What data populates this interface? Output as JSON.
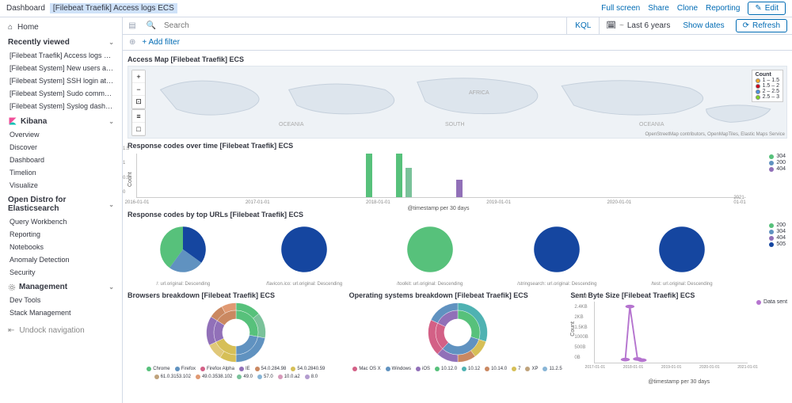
{
  "header": {
    "crumb_root": "Dashboard",
    "crumb_current": "[Filebeat Traefik] Access logs ECS",
    "actions": [
      "Full screen",
      "Share",
      "Clone",
      "Reporting"
    ],
    "edit_label": "Edit"
  },
  "sidebar": {
    "home": "Home",
    "recently_viewed_label": "Recently viewed",
    "recently_viewed": [
      "[Filebeat Traefik] Access logs ECS",
      "[Filebeat System] New users and group...",
      "[Filebeat System] SSH login attempts E...",
      "[Filebeat System] Sudo commands ECS",
      "[Filebeat System] Syslog dashboard ECS"
    ],
    "kibana_label": "Kibana",
    "kibana": [
      "Overview",
      "Discover",
      "Dashboard",
      "Timelion",
      "Visualize"
    ],
    "opendistro_label": "Open Distro for Elasticsearch",
    "opendistro": [
      "Query Workbench",
      "Reporting",
      "Notebooks",
      "Anomaly Detection",
      "Security"
    ],
    "management_label": "Management",
    "management": [
      "Dev Tools",
      "Stack Management"
    ],
    "undock": "Undock navigation"
  },
  "query": {
    "search_placeholder": "Search",
    "kql": "KQL",
    "date_range": "Last 6 years",
    "show_dates": "Show dates",
    "refresh": "Refresh",
    "add_filter": "+ Add filter"
  },
  "panels": {
    "map_title": "Access Map [Filebeat Traefik] ECS",
    "map_labels": {
      "oceania1": "OCEANIA",
      "south": "SOUTH",
      "africa": "AFRICA",
      "oceania2": "OCEANIA"
    },
    "map_legend_title": "Count",
    "map_legend": [
      {
        "label": "1 – 1.5",
        "color": "#f5a623"
      },
      {
        "label": "1.5 – 2",
        "color": "#d0021b"
      },
      {
        "label": "2 – 2.5",
        "color": "#4a90e2"
      },
      {
        "label": "2.5 – 3",
        "color": "#7ed321"
      }
    ],
    "map_attribution": "OpenStreetMap contributors, OpenMapTiles, Elastic Maps Service",
    "response_time_title": "Response codes over time [Filebeat Traefik] ECS",
    "response_time_legend": [
      {
        "label": "304",
        "color": "#57c17b"
      },
      {
        "label": "200",
        "color": "#6092c0"
      },
      {
        "label": "404",
        "color": "#9170b8"
      }
    ],
    "response_url_title": "Response codes by top URLs [Filebeat Traefik] ECS",
    "response_url_legend": [
      {
        "label": "200",
        "color": "#57c17b"
      },
      {
        "label": "304",
        "color": "#6092c0"
      },
      {
        "label": "404",
        "color": "#9170b8"
      },
      {
        "label": "505",
        "color": "#1546a0"
      }
    ],
    "browsers_title": "Browsers breakdown [Filebeat Traefik] ECS",
    "os_title": "Operating systems breakdown [Filebeat Traefik] ECS",
    "bytes_title": "Sent Byte Size [Filebeat Traefik] ECS",
    "bytes_legend": "Data sent",
    "bytes_color": "#b574cf"
  },
  "chart_data": {
    "response_over_time": {
      "type": "bar",
      "ylabel": "Count",
      "xlabel": "@timestamp per 30 days",
      "ylim": [
        0,
        1.5
      ],
      "yticks": [
        0,
        0.5,
        1,
        1.5
      ],
      "xticks": [
        "2016-01-01",
        "2017-01-01",
        "2018-01-01",
        "2019-01-01",
        "2020-01-01",
        "2021-01-01"
      ],
      "bars": [
        {
          "x_pct": 38,
          "h": 1.5,
          "color": "#57c17b"
        },
        {
          "x_pct": 43,
          "h": 1.5,
          "color": "#57c17b"
        },
        {
          "x_pct": 44.5,
          "h": 1.0,
          "color": "#7ac29a"
        },
        {
          "x_pct": 53,
          "h": 0.6,
          "color": "#9170b8"
        }
      ]
    },
    "response_by_url": {
      "type": "pie",
      "pies": [
        {
          "label": "/: url.original: Descending",
          "slices": [
            {
              "v": 35,
              "c": "#1546a0"
            },
            {
              "v": 25,
              "c": "#6092c0"
            },
            {
              "v": 40,
              "c": "#57c17b"
            }
          ]
        },
        {
          "label": "/favicon.ico: url.original: Descending",
          "slices": [
            {
              "v": 100,
              "c": "#1546a0"
            }
          ]
        },
        {
          "label": "/toolkit: url.original: Descending",
          "slices": [
            {
              "v": 100,
              "c": "#57c17b"
            }
          ]
        },
        {
          "label": "/stringsearch: url.original: Descending",
          "slices": [
            {
              "v": 100,
              "c": "#1546a0"
            }
          ]
        },
        {
          "label": "/test: url.original: Descending",
          "slices": [
            {
              "v": 100,
              "c": "#1546a0"
            }
          ]
        }
      ]
    },
    "browsers": {
      "type": "donut",
      "inner": [
        {
          "v": 28,
          "c": "#57c17b"
        },
        {
          "v": 22,
          "c": "#6092c0"
        },
        {
          "v": 18,
          "c": "#d6bf57"
        },
        {
          "v": 16,
          "c": "#9170b8"
        },
        {
          "v": 16,
          "c": "#ca8861"
        }
      ],
      "outer": [
        {
          "v": 14,
          "c": "#57c17b"
        },
        {
          "v": 14,
          "c": "#7ac29a"
        },
        {
          "v": 22,
          "c": "#6092c0"
        },
        {
          "v": 9,
          "c": "#d6bf57"
        },
        {
          "v": 9,
          "c": "#e0c879"
        },
        {
          "v": 16,
          "c": "#9170b8"
        },
        {
          "v": 8,
          "c": "#ca8861"
        },
        {
          "v": 8,
          "c": "#e09972"
        }
      ],
      "legend": [
        {
          "label": "Chrome",
          "c": "#57c17b"
        },
        {
          "label": "Firefox",
          "c": "#6092c0"
        },
        {
          "label": "Firefox Alpha",
          "c": "#d36086"
        },
        {
          "label": "IE",
          "c": "#9170b8"
        },
        {
          "label": "54.0.284.98",
          "c": "#ca8861"
        },
        {
          "label": "54.0.2840.59",
          "c": "#d6bf57"
        },
        {
          "label": "61.0.3153.102",
          "c": "#bfa37c"
        },
        {
          "label": "49.0.3538.102",
          "c": "#e09972"
        },
        {
          "label": "49.0",
          "c": "#7ac29a"
        },
        {
          "label": "57.0",
          "c": "#88b5d6"
        },
        {
          "label": "10.0.a2",
          "c": "#d699b9"
        },
        {
          "label": "8.0",
          "c": "#b39ccf"
        }
      ]
    },
    "os": {
      "type": "donut",
      "inner": [
        {
          "v": 30,
          "c": "#57c17b"
        },
        {
          "v": 32,
          "c": "#6092c0"
        },
        {
          "v": 20,
          "c": "#d36086"
        },
        {
          "v": 18,
          "c": "#9170b8"
        }
      ],
      "outer": [
        {
          "v": 30,
          "c": "#4fb2b2"
        },
        {
          "v": 10,
          "c": "#d6bf57"
        },
        {
          "v": 10,
          "c": "#ca8861"
        },
        {
          "v": 12,
          "c": "#9170b8"
        },
        {
          "v": 20,
          "c": "#d36086"
        },
        {
          "v": 18,
          "c": "#6092c0"
        }
      ],
      "legend": [
        {
          "label": "Mac OS X",
          "c": "#d36086"
        },
        {
          "label": "Windows",
          "c": "#6092c0"
        },
        {
          "label": "iOS",
          "c": "#9170b8"
        },
        {
          "label": "10.12.0",
          "c": "#57c17b"
        },
        {
          "label": "10.12",
          "c": "#4fb2b2"
        },
        {
          "label": "10.14.0",
          "c": "#ca8861"
        },
        {
          "label": "7",
          "c": "#d6bf57"
        },
        {
          "label": "XP",
          "c": "#bfa37c"
        },
        {
          "label": "11.2.5",
          "c": "#88b5d6"
        }
      ]
    },
    "sent_bytes": {
      "type": "line",
      "ylabel": "Count",
      "xlabel": "@timestamp per 30 days",
      "yticks": [
        "0B",
        "500B",
        "1000B",
        "1.5KB",
        "2KB",
        "2.4KB",
        "2.9KB"
      ],
      "xticks": [
        "2017-01-01",
        "2018-01-01",
        "2019-01-01",
        "2020-01-01",
        "2021-01-01"
      ],
      "points": [
        {
          "x": 0.2,
          "y": 0.05
        },
        {
          "x": 0.23,
          "y": 0.92
        },
        {
          "x": 0.28,
          "y": 0.06
        },
        {
          "x": 0.31,
          "y": 0.04
        }
      ]
    }
  }
}
